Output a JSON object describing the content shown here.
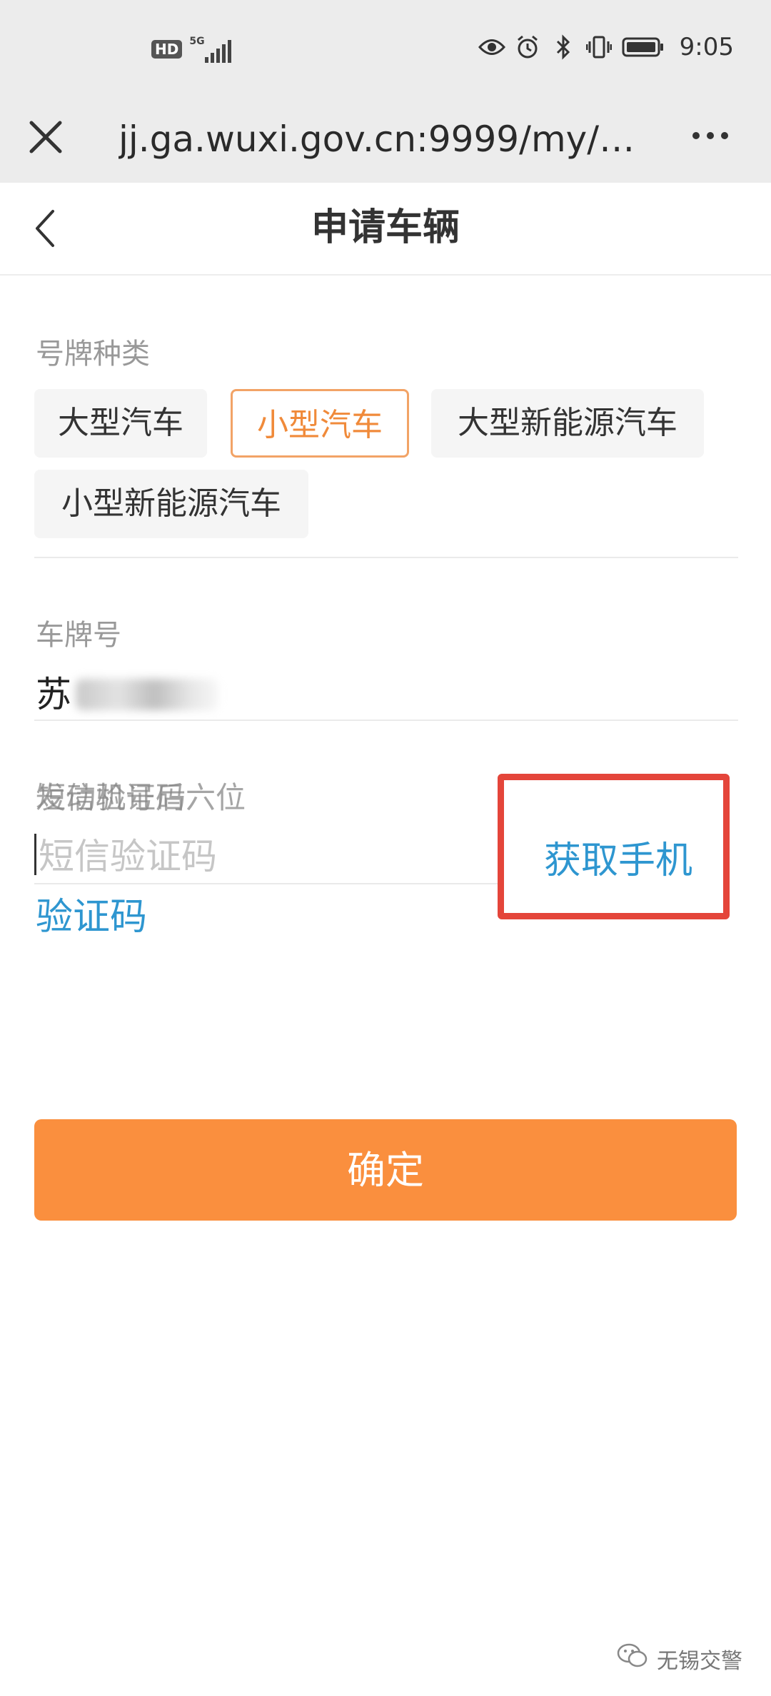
{
  "status_bar": {
    "hd_label": "HD",
    "network": "5G",
    "time": "9:05",
    "icons": [
      "eye-icon",
      "alarm-icon",
      "bluetooth-icon",
      "vibrate-icon",
      "battery-icon"
    ]
  },
  "browser": {
    "url": "jj.ga.wuxi.gov.cn:9999/my/my...",
    "icons": [
      "close-icon",
      "more-icon"
    ]
  },
  "nav": {
    "title": "申请车辆",
    "back_icon": "chevron-left-icon"
  },
  "plate_type": {
    "label": "号牌种类",
    "options": [
      "大型汽车",
      "小型汽车",
      "大型新能源汽车",
      "小型新能源汽车"
    ],
    "selected": "小型汽车"
  },
  "plate_number": {
    "label": "车牌号",
    "value_prefix": "苏"
  },
  "sms": {
    "label_overlap": [
      "短信验证码",
      "发动机号后六位"
    ],
    "placeholder": "短信验证码",
    "get_code_label_line1": "获取手机",
    "get_code_label_line2": "验证码"
  },
  "confirm": {
    "label": "确定"
  },
  "watermark": {
    "text": "无锡交警"
  },
  "colors": {
    "accent_orange": "#fa8f3e",
    "link_blue": "#2e96d0",
    "highlight_red": "#e4453a"
  }
}
